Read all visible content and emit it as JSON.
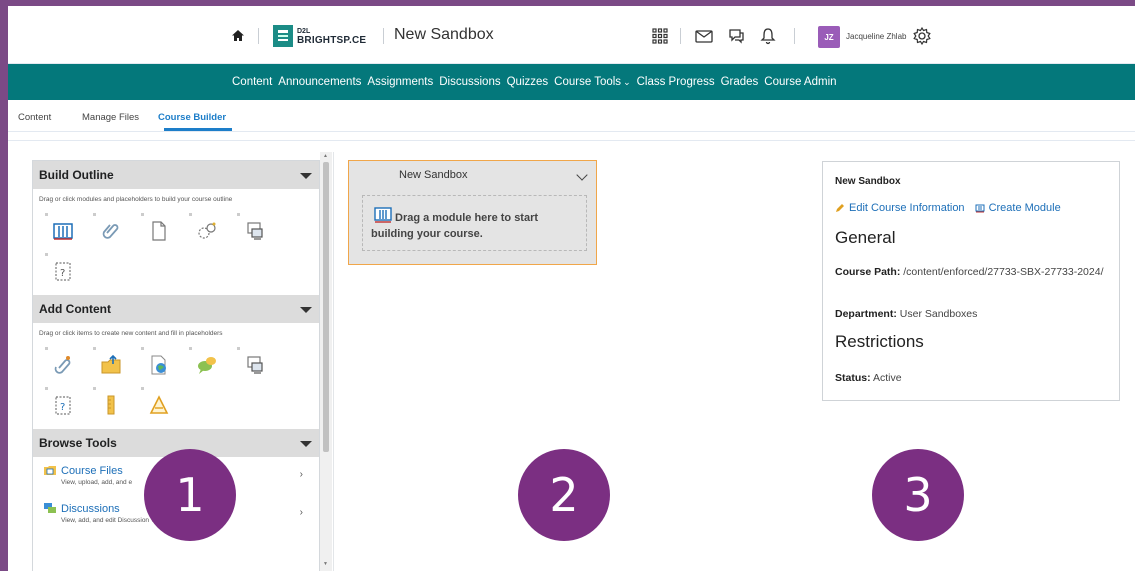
{
  "header": {
    "logo_small": "D2L",
    "logo_big": "BRIGHTSP",
    "logo_big2": "CE",
    "course_title": "New Sandbox",
    "user_initials": "JZ",
    "user_name": "Jacqueline Zhlab"
  },
  "navbar": {
    "items": [
      "Content",
      "Announcements",
      "Assignments",
      "Discussions",
      "Quizzes",
      "Course Tools",
      "Class Progress",
      "Grades",
      "Course Admin"
    ]
  },
  "tabs": [
    "Content",
    "Manage Files",
    "Course Builder"
  ],
  "left_panel": {
    "build_outline": {
      "title": "Build Outline",
      "description": "Drag or click modules and placeholders to build your course outline"
    },
    "add_content": {
      "title": "Add Content",
      "description": "Drag or click items to create new content and fill in placeholders"
    },
    "browse_tools": {
      "title": "Browse Tools",
      "items": [
        {
          "name": "Course Files",
          "desc": "View, upload, add, and e"
        },
        {
          "name": "Discussions",
          "desc": "View, add, and edit Discussion Topics"
        }
      ]
    }
  },
  "module": {
    "title": "New Sandbox",
    "drop_text": "Drag a module here to start building your course."
  },
  "info_panel": {
    "title": "New Sandbox",
    "edit_link": "Edit Course Information",
    "create_link": "Create Module",
    "general_heading": "General",
    "course_path_label": "Course Path:",
    "course_path_value": "/content/enforced/27733-SBX-27733-2024/",
    "department_label": "Department:",
    "department_value": "User Sandboxes",
    "restrictions_heading": "Restrictions",
    "status_label": "Status:",
    "status_value": "Active"
  },
  "callouts": [
    "1",
    "2",
    "3"
  ],
  "colors": {
    "frame": "#7b4a86",
    "navbar": "#04787b",
    "accent_link": "#1d6fb8",
    "callout": "#7b2f82",
    "module_border": "#f0a64a"
  }
}
